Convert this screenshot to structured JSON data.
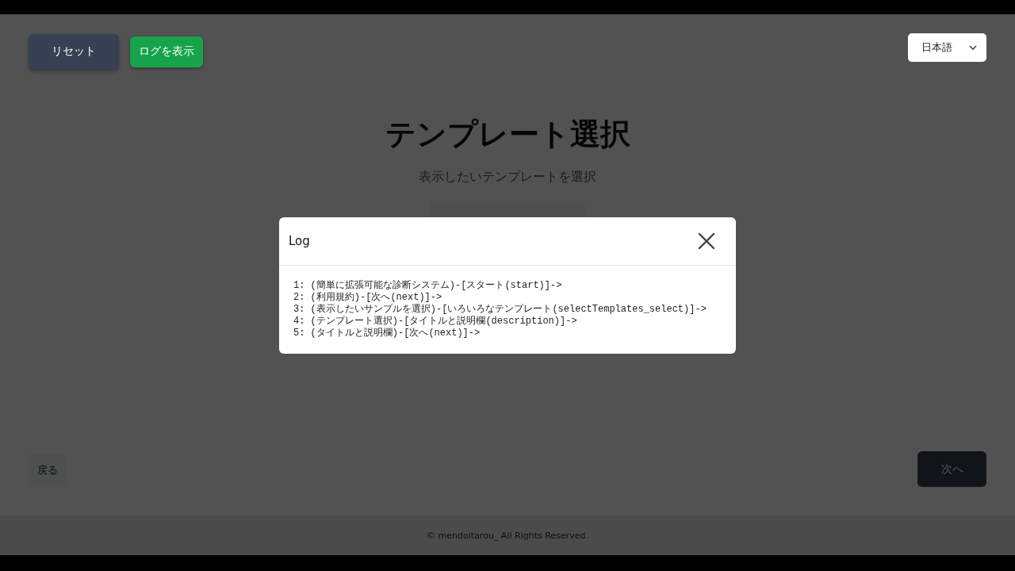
{
  "header": {
    "reset_button": "リセット",
    "log_button": "ログを表示",
    "language": "日本語"
  },
  "title": "テンプレート選択",
  "subtitle": "表示したいテンプレートを選択",
  "navigation": {
    "back_button": {
      "label": "戻る",
      "disabled": false
    },
    "next_button": {
      "label": "次へ",
      "disabled": true
    }
  },
  "footer": "© mendoitarou_ All Rights Reserved.",
  "log_dialog": {
    "title": "Log",
    "lines": [
      "1: (簡単に拡張可能な診断システム)-[スタート(start)]->",
      "2: (利用規約)-[次へ(next)]->",
      "3: (表示したいサンプルを選択)-[いろいろなテンプレート(selectTemplates_select)]->",
      "4: (テンプレート選択)-[タイトルと説明欄(description)]->",
      "5: (タイトルと説明欄)-[次へ(next)]->"
    ]
  }
}
